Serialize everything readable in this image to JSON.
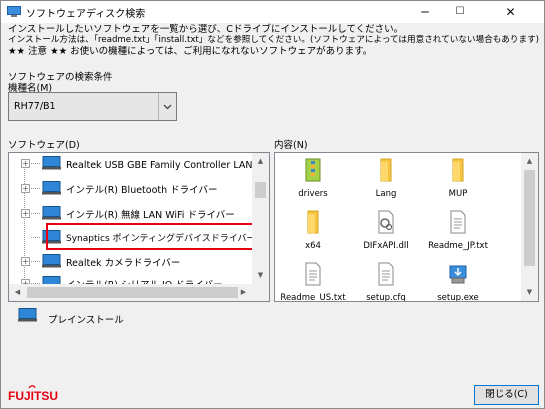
{
  "window": {
    "title": "ソフトウェアディスク検索",
    "minimize": "─",
    "maximize": "☐",
    "close": "✕"
  },
  "messages": [
    "インストールしたいソフトウェアを一覧から選び、Cドライブにインストールしてください。",
    "インストール方法は、「readme.txt」「install.txt」などを参照してください。(ソフトウェアによっては用意されていない場合もあります)",
    "★★ 注意 ★★ お使いの機種によっては、ご利用になれないソフトウェアがあります。"
  ],
  "search": {
    "section_label": "ソフトウェアの検索条件",
    "model_label": "機種名(M)",
    "model_value": "RH77/B1"
  },
  "software": {
    "label": "ソフトウェア(D)",
    "items": [
      {
        "label": "Realtek USB GBE Family Controller LAN ドライバー"
      },
      {
        "label": "インテル(R) Bluetooth ドライバー"
      },
      {
        "label": "インテル(R) 無線 LAN WiFi ドライバー"
      },
      {
        "label": "Synaptics ポインティングデバイスドライバー"
      },
      {
        "label": "Realtek カメラドライバー"
      },
      {
        "label": "インテル(R) シリアル IO ドライバー"
      }
    ]
  },
  "contents": {
    "label": "内容(N)",
    "files": [
      {
        "name": "drivers",
        "icon": "archive-icon"
      },
      {
        "name": "Lang",
        "icon": "folder-icon"
      },
      {
        "name": "MUP",
        "icon": "folder-icon"
      },
      {
        "name": "x64",
        "icon": "folder-icon"
      },
      {
        "name": "DIFxAPI.dll",
        "icon": "dll-icon"
      },
      {
        "name": "Readme_JP.txt",
        "icon": "text-file-icon"
      },
      {
        "name": "Readme_US.txt",
        "icon": "text-file-icon"
      },
      {
        "name": "setup.cfg",
        "icon": "text-file-icon"
      },
      {
        "name": "setup.exe",
        "icon": "installer-icon"
      }
    ]
  },
  "preinstall_label": "プレインストール",
  "close_button": "閉じる(C)",
  "brand": "FUJITSU",
  "colors": {
    "highlight": "#e60012",
    "brand_red": "#e60012",
    "folder": "#f5c542",
    "focus_blue": "#0078d7"
  }
}
